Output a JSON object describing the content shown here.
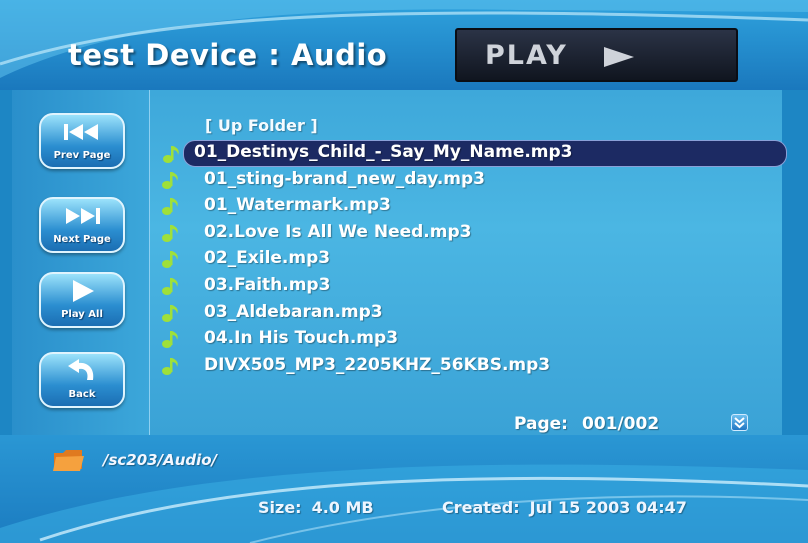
{
  "header": {
    "title": "test Device : Audio",
    "play_status": "PLAY"
  },
  "sidebar": {
    "buttons": [
      {
        "label": "Prev Page",
        "icon": "skip-back-icon"
      },
      {
        "label": "Next Page",
        "icon": "skip-forward-icon"
      },
      {
        "label": "Play All",
        "icon": "play-icon"
      },
      {
        "label": "Back",
        "icon": "back-arrow-icon"
      }
    ]
  },
  "file_list": {
    "up_folder": "[ Up Folder ]",
    "items": [
      "01_Destinys_Child_-_Say_My_Name.mp3",
      "01_sting-brand_new_day.mp3",
      "01_Watermark.mp3",
      "02.Love Is All We Need.mp3",
      "02_Exile.mp3",
      "03.Faith.mp3",
      "03_Aldebaran.mp3",
      "04.In His Touch.mp3",
      "DIVX505_MP3_2205KHZ_56KBS.mp3"
    ],
    "selected_index": 0
  },
  "pagination": {
    "label": "Page:",
    "value": "001/002"
  },
  "footer": {
    "path": "/sc203/Audio/",
    "size_label": "Size:",
    "size_value": "4.0 MB",
    "created_label": "Created:",
    "created_value": "Jul 15 2003 04:47"
  },
  "colors": {
    "selection": "#1c2a63",
    "note_icon": "#9fe03a",
    "folder_icon": "#f08a2a"
  }
}
